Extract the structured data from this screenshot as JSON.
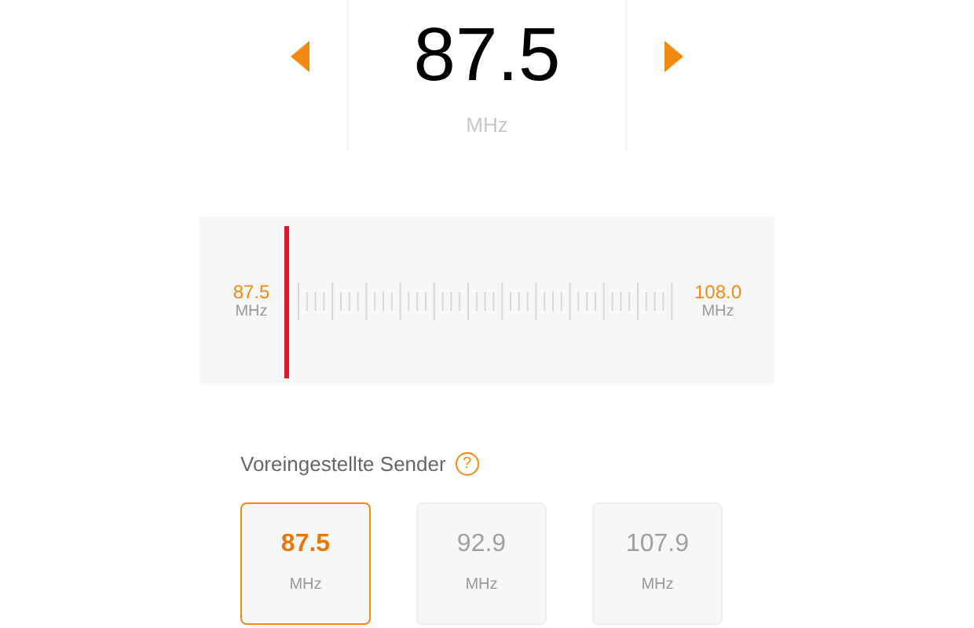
{
  "frequency": {
    "value": "87.5",
    "unit": "MHz"
  },
  "tuner": {
    "min_value": "87.5",
    "min_unit": "MHz",
    "max_value": "108.0",
    "max_unit": "MHz",
    "level": 0
  },
  "presets": {
    "title": "Voreingestellte Sender",
    "help": "?",
    "items": [
      {
        "value": "87.5",
        "unit": "MHz",
        "selected": true
      },
      {
        "value": "92.9",
        "unit": "MHz",
        "selected": false
      },
      {
        "value": "107.9",
        "unit": "MHz",
        "selected": false
      }
    ]
  }
}
